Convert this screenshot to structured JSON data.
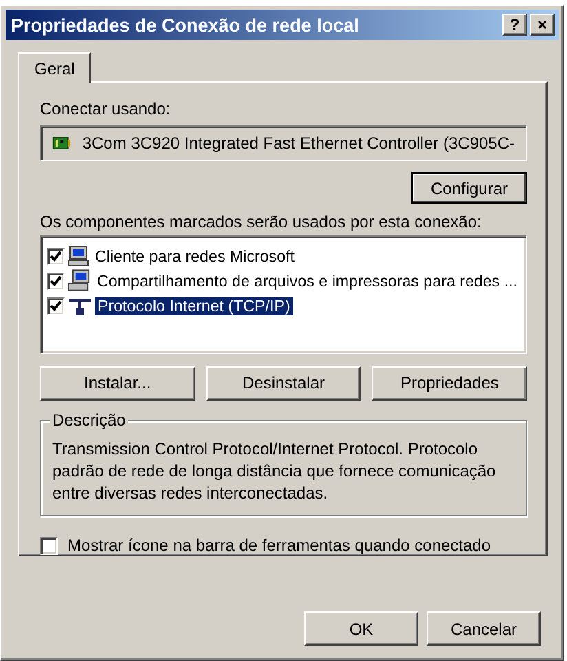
{
  "window": {
    "title": "Propriedades de Conexão de rede local",
    "help_button": "?",
    "close_button": "×"
  },
  "tabs": [
    {
      "label": "Geral",
      "selected": true
    }
  ],
  "connect_label": "Conectar usando:",
  "adapter": "3Com 3C920 Integrated Fast Ethernet Controller (3C905C-",
  "configure_button": "Configurar",
  "components_label": "Os componentes marcados serão usados por esta conexão:",
  "components": [
    {
      "kind": "client",
      "label": "Cliente para redes Microsoft",
      "checked": true,
      "selected": false
    },
    {
      "kind": "service",
      "label": "Compartilhamento de arquivos e impressoras para redes ...",
      "checked": true,
      "selected": false
    },
    {
      "kind": "protocol",
      "label": "Protocolo Internet (TCP/IP)",
      "checked": true,
      "selected": true
    }
  ],
  "component_buttons": [
    "Instalar...",
    "Desinstalar",
    "Propriedades"
  ],
  "description": {
    "title": "Descrição",
    "text": "Transmission Control Protocol/Internet Protocol. Protocolo padrão de rede de longa distância que fornece comunicação entre diversas redes interconectadas."
  },
  "show_icon": {
    "label": "Mostrar ícone na barra de ferramentas quando conectado",
    "checked": false
  },
  "buttons": [
    "OK",
    "Cancelar"
  ]
}
